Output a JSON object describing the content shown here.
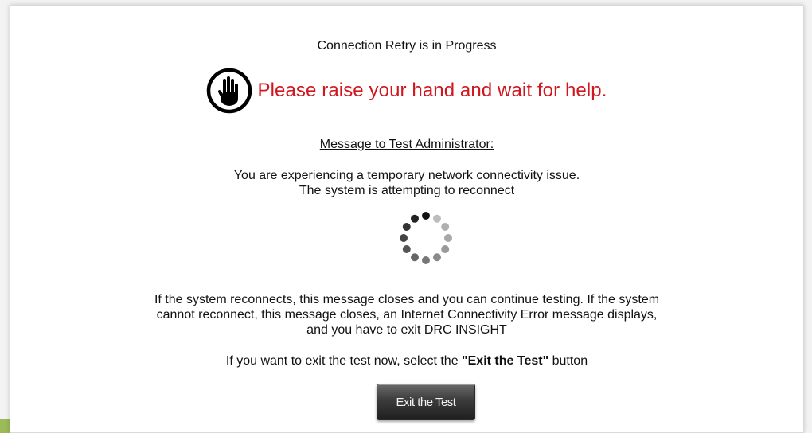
{
  "dialog": {
    "title": "Connection Retry is in Progress",
    "alert_text": "Please raise your hand and wait for help.",
    "alert_color": "#d0161e",
    "alert_icon": "raised-hand-icon",
    "subheading": "Message to Test Administrator:",
    "message_line1": "You are experiencing a temporary network connectivity issue.",
    "message_line2": "The system is attempting to reconnect",
    "spinner_icon": "loading-spinner-icon",
    "paragraph_line1": "If the system reconnects, this message closes and you can continue testing. If the system",
    "paragraph_line2": "cannot reconnect, this message closes, an Internet Connectivity Error message displays,",
    "paragraph_line3": "and you have to exit DRC INSIGHT",
    "exit_prompt_before": "If you want to exit the test now, select the ",
    "exit_prompt_bold": "\"Exit the Test\"",
    "exit_prompt_after": " button",
    "exit_button_label": "Exit the Test"
  }
}
